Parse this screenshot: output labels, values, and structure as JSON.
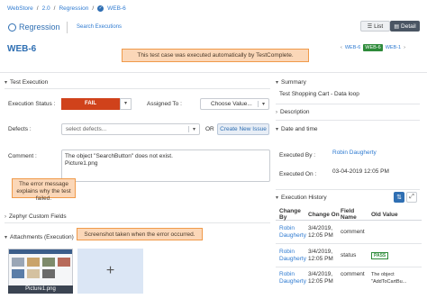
{
  "breadcrumb": {
    "root": "WebStore",
    "version": "2.0",
    "cycle": "Regression",
    "current": "WEB-6",
    "sep": "/"
  },
  "nav": {
    "app_title": "Regression",
    "search_executions": "Search Executions",
    "view_list": "List",
    "view_detail": "Detail"
  },
  "header": {
    "title": "WEB-6",
    "pager": [
      "WEB-6",
      "WEB-6",
      "WEB-1"
    ]
  },
  "callouts": {
    "top": "This test case was executed automatically by TestComplete.",
    "error": "The error message explains why the test failed.",
    "screenshot": "Screenshot taken when the error occurred."
  },
  "test_execution": {
    "section": "Test Execution",
    "status_label": "Execution Status :",
    "status_value": "FAIL",
    "assigned_label": "Assigned To :",
    "assigned_placeholder": "Choose Value...",
    "defects_label": "Defects :",
    "defects_placeholder": "select defects...",
    "or": "OR",
    "create_issue": "Create New Issue",
    "comment_label": "Comment :",
    "comment_line1": "The object \"SearchButton\" does not exist.",
    "comment_line2": "Picture1.png"
  },
  "zephyr": {
    "section": "Zephyr Custom Fields"
  },
  "attachments": {
    "section": "Attachments (Execution)",
    "file_name": "Picture1.png",
    "add_symbol": "+"
  },
  "summary": {
    "section": "Summary",
    "text": "Test Shopping Cart - Data loop"
  },
  "description": {
    "section": "Description"
  },
  "date_time": {
    "section": "Date and time",
    "executed_by_label": "Executed By :",
    "executed_by_value": "Robin Daugherty",
    "executed_on_label": "Executed On :",
    "executed_on_value": "03-04-2019 12:05 PM"
  },
  "history": {
    "section": "Execution History",
    "columns": [
      "Change By",
      "Change On",
      "Field Name",
      "Old Value"
    ],
    "rows": [
      {
        "by1": "Robin",
        "by2": "Daugherty",
        "on1": "3/4/2019,",
        "on2": "12:05 PM",
        "field": "comment",
        "old": ""
      },
      {
        "by1": "Robin",
        "by2": "Daugherty",
        "on1": "3/4/2019,",
        "on2": "12:05 PM",
        "field": "status",
        "old": "PASS"
      },
      {
        "by1": "Robin",
        "by2": "Daugherty",
        "on1": "3/4/2019,",
        "on2": "12:05 PM",
        "field": "comment",
        "old": "The object \"AddToCartBu..."
      }
    ]
  },
  "colors": {
    "fail": "#d0421b",
    "pass": "#2e8b3a",
    "callout_bg": "#fbd7b8",
    "callout_border": "#f09a4a",
    "link": "#2f7bd1",
    "primary": "#2f6fb3"
  }
}
